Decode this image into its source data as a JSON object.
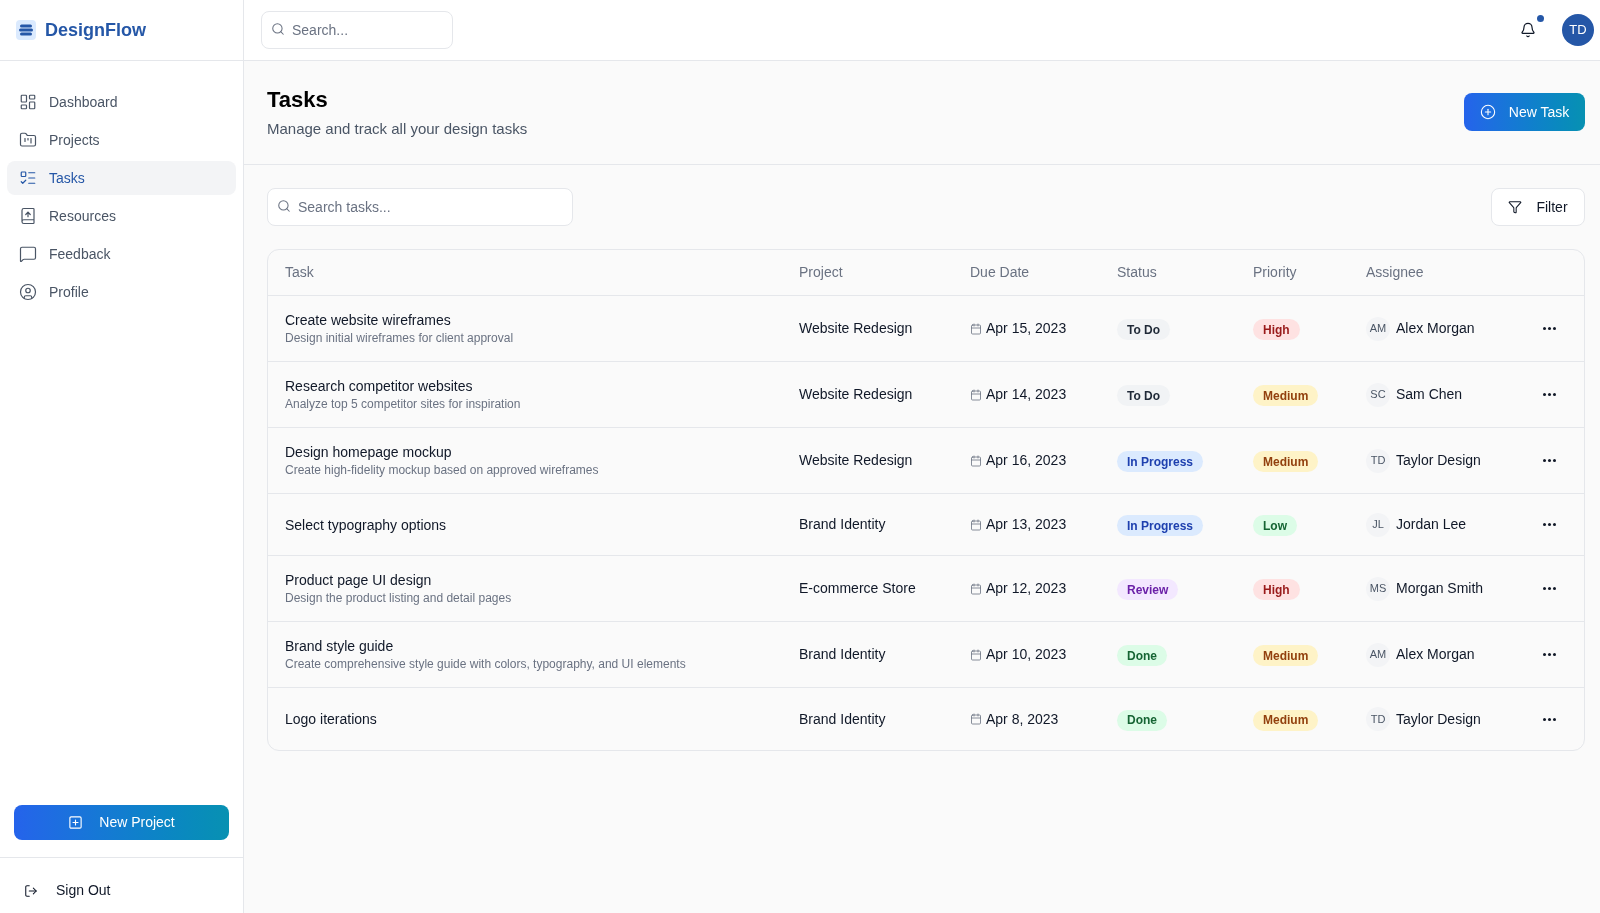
{
  "sidebar": {
    "brand": "DesignFlow",
    "nav": [
      {
        "label": "Dashboard",
        "selected": false
      },
      {
        "label": "Projects",
        "selected": false
      },
      {
        "label": "Tasks",
        "selected": true
      },
      {
        "label": "Resources",
        "selected": false
      },
      {
        "label": "Feedback",
        "selected": false
      },
      {
        "label": "Profile",
        "selected": false
      }
    ],
    "new_project_button": "New Project",
    "sign_out": "Sign Out"
  },
  "topbar": {
    "search": {
      "placeholder": "Search..."
    },
    "notifications_unread": true,
    "avatar_initials": "TD"
  },
  "page": {
    "title": "Tasks",
    "subtitle": "Manage and track all your design tasks",
    "new_task_button": "New Task"
  },
  "toolbar": {
    "search": {
      "placeholder": "Search tasks..."
    },
    "filter_button": "Filter"
  },
  "table": {
    "columns": [
      "Task",
      "Project",
      "Due Date",
      "Status",
      "Priority",
      "Assignee"
    ],
    "rows": [
      {
        "title": "Create website wireframes",
        "description": "Design initial wireframes for client approval",
        "project": "Website Redesign",
        "due_date": "Apr 15, 2023",
        "status": {
          "label": "To Do",
          "color": "#1f2937"
        },
        "priority": {
          "label": "High",
          "color": "#991b1b"
        },
        "assignee": {
          "initials": "AM",
          "name": "Alex Morgan"
        }
      },
      {
        "title": "Research competitor websites",
        "description": "Analyze top 5 competitor sites for inspiration",
        "project": "Website Redesign",
        "due_date": "Apr 14, 2023",
        "status": {
          "label": "To Do",
          "color": "#1f2937"
        },
        "priority": {
          "label": "Medium",
          "color": "#92400e"
        },
        "assignee": {
          "initials": "SC",
          "name": "Sam Chen"
        }
      },
      {
        "title": "Design homepage mockup",
        "description": "Create high-fidelity mockup based on approved wireframes",
        "project": "Website Redesign",
        "due_date": "Apr 16, 2023",
        "status": {
          "label": "In Progress",
          "color": "#1e40af"
        },
        "priority": {
          "label": "Medium",
          "color": "#92400e"
        },
        "assignee": {
          "initials": "TD",
          "name": "Taylor Design"
        }
      },
      {
        "title": "Select typography options",
        "project": "Brand Identity",
        "due_date": "Apr 13, 2023",
        "status": {
          "label": "In Progress",
          "color": "#1e40af"
        },
        "priority": {
          "label": "Low",
          "color": "#166534"
        },
        "assignee": {
          "initials": "JL",
          "name": "Jordan Lee"
        }
      },
      {
        "title": "Product page UI design",
        "description": "Design the product listing and detail pages",
        "project": "E-commerce Store",
        "due_date": "Apr 12, 2023",
        "status": {
          "label": "Review",
          "color": "#6b21a8"
        },
        "priority": {
          "label": "High",
          "color": "#991b1b"
        },
        "assignee": {
          "initials": "MS",
          "name": "Morgan Smith"
        }
      },
      {
        "title": "Brand style guide",
        "description": "Create comprehensive style guide with colors, typography, and UI elements",
        "project": "Brand Identity",
        "due_date": "Apr 10, 2023",
        "status": {
          "label": "Done",
          "color": "#166534"
        },
        "priority": {
          "label": "Medium",
          "color": "#92400e"
        },
        "assignee": {
          "initials": "AM",
          "name": "Alex Morgan"
        }
      },
      {
        "title": "Logo iterations",
        "project": "Brand Identity",
        "due_date": "Apr 8, 2023",
        "status": {
          "label": "Done",
          "color": "#166534"
        },
        "priority": {
          "label": "Medium",
          "color": "#92400e"
        },
        "assignee": {
          "initials": "TD",
          "name": "Taylor Design"
        }
      }
    ]
  }
}
